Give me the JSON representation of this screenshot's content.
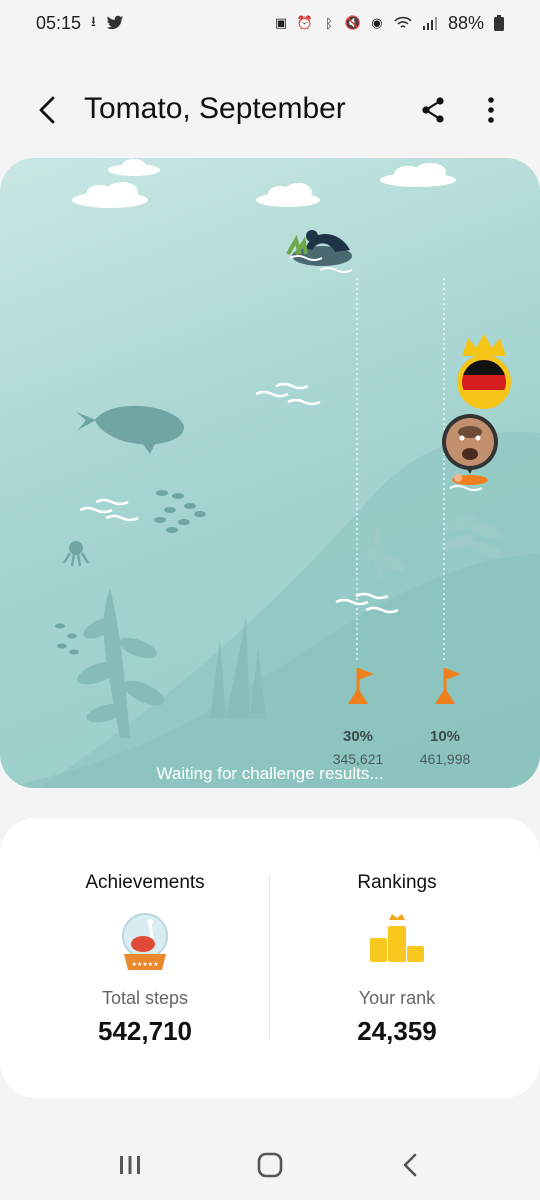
{
  "status_bar": {
    "time": "05:15",
    "battery": "88%",
    "left_icons": [
      "download-icon",
      "twitter-icon"
    ],
    "right_icons": [
      "screenshot-icon",
      "alarm-icon",
      "bluetooth-icon",
      "mute-icon",
      "location-icon",
      "wifi-icon",
      "signal-icon",
      "battery-icon"
    ]
  },
  "app_bar": {
    "title": "Tomato, September",
    "icons": [
      "back-arrow-icon",
      "share-icon",
      "more-vert-icon"
    ]
  },
  "challenge": {
    "waiting_text": "Waiting for challenge results...",
    "markers": [
      {
        "percent": "30%",
        "steps": "345,621"
      },
      {
        "percent": "10%",
        "steps": "461,998"
      }
    ],
    "colors": {
      "flag": "#f07f1e",
      "crown": "#f5c518",
      "sea": "#a7d5d1"
    }
  },
  "stats": {
    "achievements": {
      "heading": "Achievements",
      "label": "Total steps",
      "value": "542,710",
      "icon": "trophy-globe-icon"
    },
    "rankings": {
      "heading": "Rankings",
      "label": "Your rank",
      "value": "24,359",
      "icon": "podium-icon"
    }
  },
  "nav_bar": {
    "icons": [
      "recent-apps-icon",
      "home-icon",
      "nav-back-icon"
    ]
  }
}
